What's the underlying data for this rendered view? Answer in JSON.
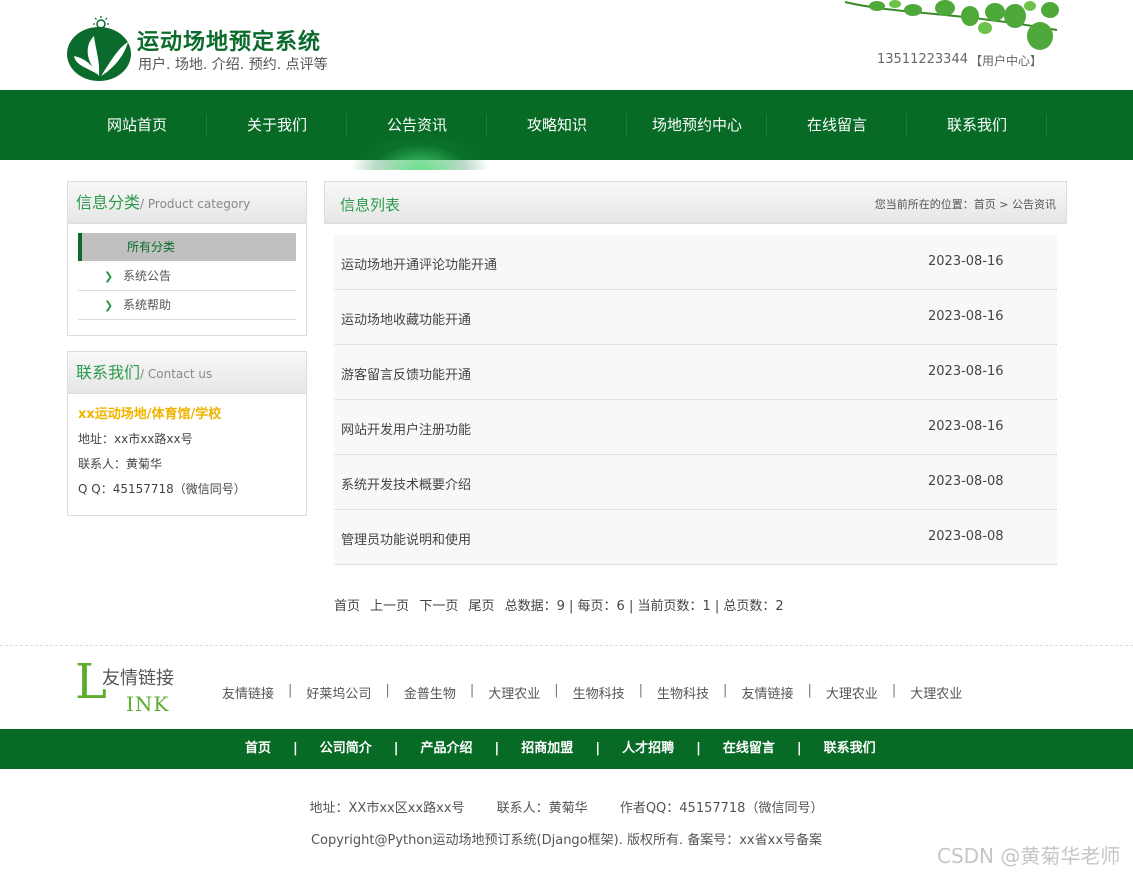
{
  "header": {
    "title": "运动场地预定系统",
    "subtitle": "用户. 场地. 介绍. 预约. 点评等",
    "phone": "13511223344",
    "user_center": "【用户中心】"
  },
  "nav": {
    "items": [
      {
        "label": "网站首页"
      },
      {
        "label": "关于我们"
      },
      {
        "label": "公告资讯"
      },
      {
        "label": "攻略知识"
      },
      {
        "label": "场地预约中心"
      },
      {
        "label": "在线留言"
      },
      {
        "label": "联系我们"
      }
    ],
    "active_index": 2
  },
  "sidebar": {
    "category": {
      "title_cn": "信息分类",
      "title_en": "/ Product category",
      "items": [
        {
          "label": "所有分类",
          "active": true
        },
        {
          "label": "系统公告"
        },
        {
          "label": "系统帮助"
        }
      ]
    },
    "contact": {
      "title_cn": "联系我们",
      "title_en": "/ Contact us",
      "name": "xx运动场地/体育馆/学校",
      "address": "地址：xx市xx路xx号",
      "person": "联系人：黄菊华",
      "qq": "Q Q：45157718（微信同号）"
    }
  },
  "main": {
    "title": "信息列表",
    "breadcrumb_prefix": "您当前所在的位置：",
    "breadcrumb_home": "首页",
    "breadcrumb_sep": ">",
    "breadcrumb_current": "公告资讯",
    "rows": [
      {
        "title": "运动场地开通评论功能开通",
        "date": "2023-08-16"
      },
      {
        "title": "运动场地收藏功能开通",
        "date": "2023-08-16"
      },
      {
        "title": "游客留言反馈功能开通",
        "date": "2023-08-16"
      },
      {
        "title": "网站开发用户注册功能",
        "date": "2023-08-16"
      },
      {
        "title": "系统开发技术概要介绍",
        "date": "2023-08-08"
      },
      {
        "title": "管理员功能说明和使用",
        "date": "2023-08-08"
      }
    ],
    "pager": {
      "first": "首页",
      "prev": "上一页",
      "next": "下一页",
      "last": "尾页",
      "summary": "总数据：9 | 每页：6 | 当前页数：1 | 总页数：2"
    }
  },
  "friend_links": {
    "logo_cn": "友情链接",
    "logo_L": "L",
    "logo_ink": "INK",
    "items": [
      "友情链接",
      "好莱坞公司",
      "金普生物",
      "大理农业",
      "生物科技",
      "生物科技",
      "友情链接",
      "大理农业",
      "大理农业"
    ]
  },
  "footer": {
    "nav": [
      "首页",
      "公司简介",
      "产品介绍",
      "招商加盟",
      "人才招聘",
      "在线留言",
      "联系我们"
    ],
    "address": "地址：XX市xx区xx路xx号",
    "contact": "联系人：黄菊华",
    "qq": "作者QQ：45157718（微信同号）",
    "copyright": "Copyright@Python运动场地预订系统(Django框架). 版权所有. 备案号：xx省xx号备案"
  },
  "watermark": "CSDN @黄菊华老师",
  "colors": {
    "brand_green": "#076b26",
    "accent_green": "#2c9a4b",
    "highlight_yellow": "#f0b400"
  }
}
